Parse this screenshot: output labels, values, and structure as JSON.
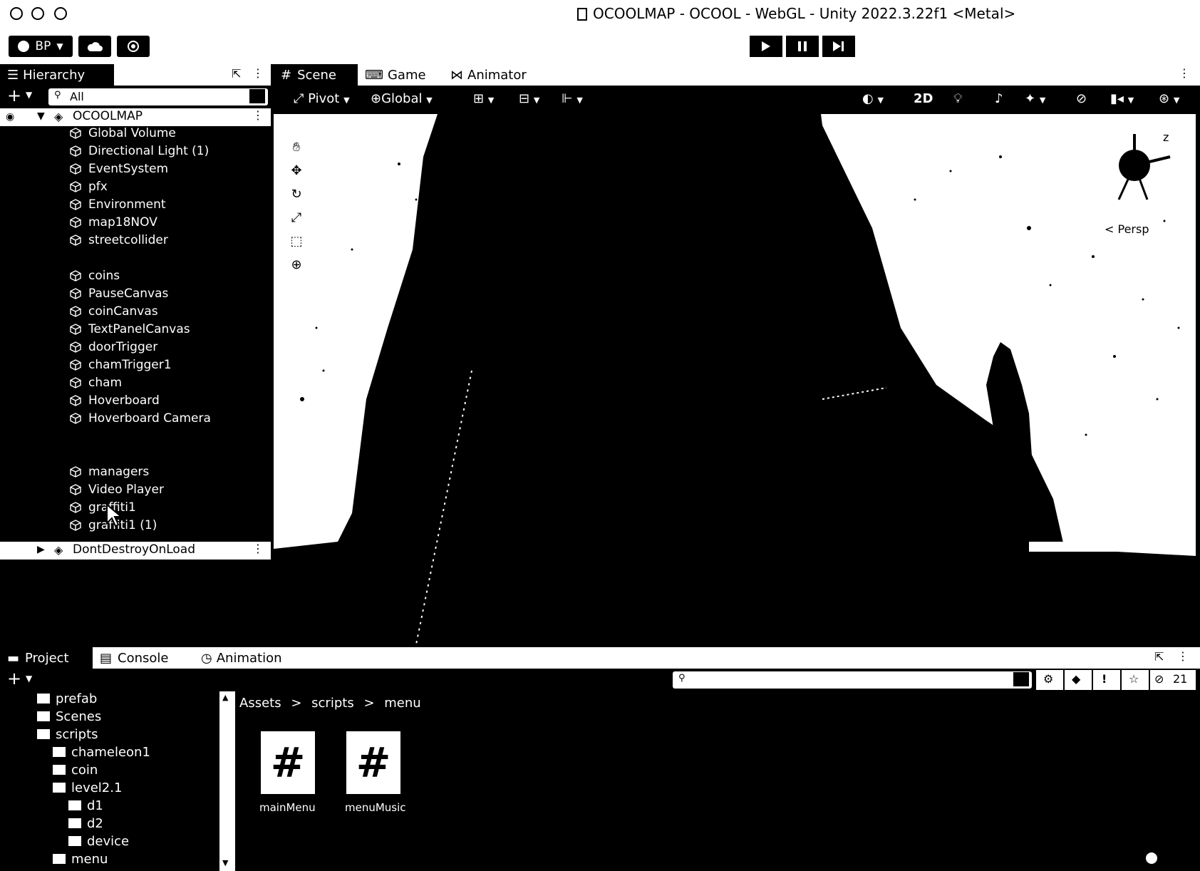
{
  "window": {
    "title": "OCOOLMAP - OCOOL - WebGL - Unity 2022.3.22f1 <Metal>"
  },
  "toolbar": {
    "account_label": "BP",
    "play_icon": "play-icon",
    "pause_icon": "pause-icon",
    "step_icon": "step-icon"
  },
  "hierarchy": {
    "tab_label": "Hierarchy",
    "search_placeholder": "All",
    "scene_name": "OCOOLMAP",
    "items": [
      "Global Volume",
      "Directional Light (1)",
      "EventSystem",
      "pfx",
      "Environment",
      "map18NOV",
      "streetcollider",
      "coins",
      "PauseCanvas",
      "coinCanvas",
      "TextPanelCanvas",
      "doorTrigger",
      "chamTrigger1",
      "cham",
      "Hoverboard",
      "Hoverboard Camera",
      "managers",
      "Video Player",
      "graffiti1",
      "graffiti1 (1)"
    ],
    "dont_destroy": "DontDestroyOnLoad"
  },
  "scene_tabs": {
    "scene": "Scene",
    "game": "Game",
    "animator": "Animator"
  },
  "scene_toolbar": {
    "pivot": "Pivot",
    "global": "Global",
    "mode_2d": "2D",
    "persp_label": "< Persp"
  },
  "bottom_tabs": {
    "project": "Project",
    "console": "Console",
    "animation": "Animation",
    "hidden_count": "21"
  },
  "project_tree": [
    {
      "name": "prefab",
      "depth": 0
    },
    {
      "name": "Scenes",
      "depth": 0
    },
    {
      "name": "scripts",
      "depth": 0
    },
    {
      "name": "chameleon1",
      "depth": 1
    },
    {
      "name": "coin",
      "depth": 1
    },
    {
      "name": "level2.1",
      "depth": 1
    },
    {
      "name": "d1",
      "depth": 2
    },
    {
      "name": "d2",
      "depth": 2
    },
    {
      "name": "device",
      "depth": 2
    },
    {
      "name": "menu",
      "depth": 1
    }
  ],
  "breadcrumb": {
    "assets": "Assets",
    "scripts": "scripts",
    "menu": "menu",
    "sep": ">"
  },
  "assets": [
    {
      "name": "mainMenu",
      "glyph": "#"
    },
    {
      "name": "menuMusic",
      "glyph": "#"
    }
  ]
}
